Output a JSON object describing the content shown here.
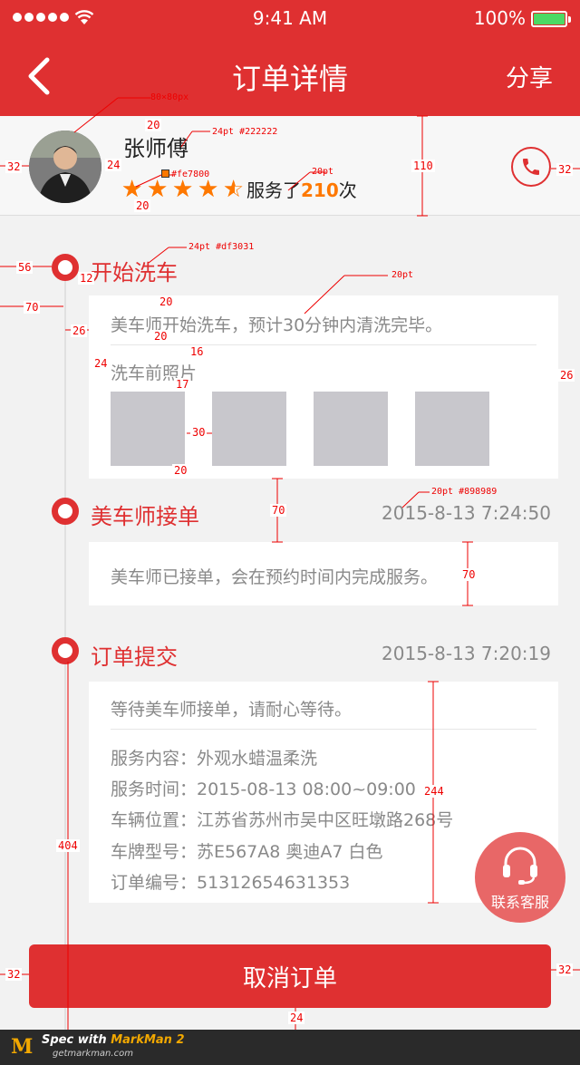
{
  "status_bar": {
    "time": "9:41 AM",
    "battery": "100%",
    "battery_level": 1.0
  },
  "nav": {
    "title": "订单详情",
    "share": "分享"
  },
  "master": {
    "name": "张师傅",
    "rating": 4.5,
    "served_prefix": "服务了",
    "served_count": "210",
    "served_suffix": "次"
  },
  "steps": [
    {
      "title": "开始洗车",
      "time": "",
      "message": "美车师开始洗车，预计30分钟内清洗完毕。",
      "photos_label": "洗车前照片",
      "photo_count": 4
    },
    {
      "title": "美车师接单",
      "time": "2015-8-13  7:24:50",
      "message": "美车师已接单，会在预约时间内完成服务。"
    },
    {
      "title": "订单提交",
      "time": "2015-8-13  7:20:19",
      "message": "等待美车师接单，请耐心等待。",
      "details": [
        "服务内容：外观水蜡温柔洗",
        "服务时间：2015-08-13  08:00~09:00",
        "车辆位置：江苏省苏州市吴中区旺墩路268号",
        "车牌型号：苏E567A8 奥迪A7 白色",
        "订单编号：51312654631353"
      ]
    }
  ],
  "customer_service": "联系客服",
  "cancel_button": "取消订单",
  "footer": {
    "spec": "Spec with ",
    "brand": "MarkMan 2",
    "url": "getmarkman.com",
    "logo": "M"
  },
  "annotations": {
    "avatar_size": "80×80px",
    "gap_20a": "20",
    "name_font": "24pt #222222",
    "left_32": "32",
    "gap_24": "24",
    "star_color": "#fe7800",
    "served_font": "20pt",
    "gap_20b": "20",
    "height_110": "110",
    "right_32": "32",
    "title_font": "24pt #df3031",
    "left_56": "56",
    "gap_12": "12",
    "msg_font": "20pt",
    "gap_20c": "20",
    "left_70": "70",
    "gap_26": "26",
    "gap_20d": "20",
    "gap_16": "16",
    "gap_24b": "24",
    "gap_17": "17",
    "right_26": "26",
    "gap_30": "30",
    "gap_20e": "20",
    "gap_70a": "70",
    "time_font": "20pt #898989",
    "gap_70b": "70",
    "height_244": "244",
    "height_404": "404",
    "bottom_left_32": "32",
    "bottom_right_32": "32",
    "bottom_24": "24"
  },
  "colors": {
    "primary": "#df3031",
    "star": "#fe7800",
    "secondary_text": "#898989",
    "primary_text": "#222222"
  },
  "icons": [
    "chevron-left-icon",
    "wifi-icon",
    "battery-icon",
    "star-icon",
    "phone-icon",
    "headset-icon"
  ]
}
